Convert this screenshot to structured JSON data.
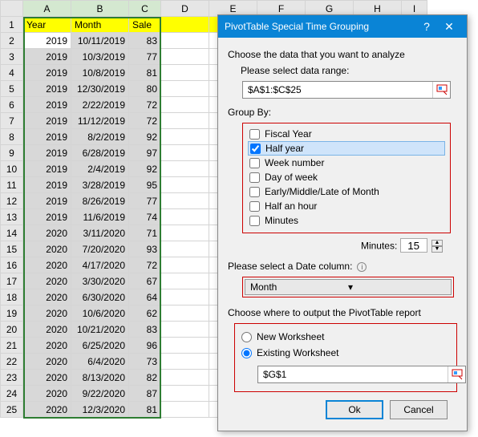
{
  "sheet": {
    "cols": [
      "A",
      "B",
      "C",
      "D",
      "E",
      "F",
      "G",
      "H",
      "I"
    ],
    "headers": {
      "A": "Year",
      "B": "Month",
      "C": "Sale"
    },
    "rows": [
      {
        "n": 1
      },
      {
        "n": 2,
        "A": "2019",
        "B": "10/11/2019",
        "C": "83"
      },
      {
        "n": 3,
        "A": "2019",
        "B": "10/3/2019",
        "C": "77"
      },
      {
        "n": 4,
        "A": "2019",
        "B": "10/8/2019",
        "C": "81"
      },
      {
        "n": 5,
        "A": "2019",
        "B": "12/30/2019",
        "C": "80"
      },
      {
        "n": 6,
        "A": "2019",
        "B": "2/22/2019",
        "C": "72"
      },
      {
        "n": 7,
        "A": "2019",
        "B": "11/12/2019",
        "C": "72"
      },
      {
        "n": 8,
        "A": "2019",
        "B": "8/2/2019",
        "C": "92"
      },
      {
        "n": 9,
        "A": "2019",
        "B": "6/28/2019",
        "C": "97"
      },
      {
        "n": 10,
        "A": "2019",
        "B": "2/4/2019",
        "C": "92"
      },
      {
        "n": 11,
        "A": "2019",
        "B": "3/28/2019",
        "C": "95"
      },
      {
        "n": 12,
        "A": "2019",
        "B": "8/26/2019",
        "C": "77"
      },
      {
        "n": 13,
        "A": "2019",
        "B": "11/6/2019",
        "C": "74"
      },
      {
        "n": 14,
        "A": "2020",
        "B": "3/11/2020",
        "C": "71"
      },
      {
        "n": 15,
        "A": "2020",
        "B": "7/20/2020",
        "C": "93"
      },
      {
        "n": 16,
        "A": "2020",
        "B": "4/17/2020",
        "C": "72"
      },
      {
        "n": 17,
        "A": "2020",
        "B": "3/30/2020",
        "C": "67"
      },
      {
        "n": 18,
        "A": "2020",
        "B": "6/30/2020",
        "C": "64"
      },
      {
        "n": 19,
        "A": "2020",
        "B": "10/6/2020",
        "C": "62"
      },
      {
        "n": 20,
        "A": "2020",
        "B": "10/21/2020",
        "C": "83"
      },
      {
        "n": 21,
        "A": "2020",
        "B": "6/25/2020",
        "C": "96"
      },
      {
        "n": 22,
        "A": "2020",
        "B": "6/4/2020",
        "C": "73"
      },
      {
        "n": 23,
        "A": "2020",
        "B": "8/13/2020",
        "C": "82"
      },
      {
        "n": 24,
        "A": "2020",
        "B": "9/22/2020",
        "C": "87"
      },
      {
        "n": 25,
        "A": "2020",
        "B": "12/3/2020",
        "C": "81"
      }
    ]
  },
  "dialog": {
    "title": "PivotTable Special Time Grouping",
    "help": "?",
    "close": "✕",
    "choose_label": "Choose the data that you want to analyze",
    "range_label": "Please select data range:",
    "range_value": "$A$1:$C$25",
    "groupby_label": "Group By:",
    "groups": [
      {
        "label": "Fiscal Year",
        "checked": false
      },
      {
        "label": "Half year",
        "checked": true
      },
      {
        "label": "Week number",
        "checked": false
      },
      {
        "label": "Day of week",
        "checked": false
      },
      {
        "label": "Early/Middle/Late of Month",
        "checked": false
      },
      {
        "label": "Half an hour",
        "checked": false
      },
      {
        "label": "Minutes",
        "checked": false
      }
    ],
    "minutes_label": "Minutes:",
    "minutes_value": "15",
    "datecol_label": "Please select a Date column:",
    "datecol_value": "Month",
    "output_label": "Choose where to output the PivotTable report",
    "output_new": "New Worksheet",
    "output_existing": "Existing Worksheet",
    "output_range": "$G$1",
    "ok": "Ok",
    "cancel": "Cancel"
  }
}
